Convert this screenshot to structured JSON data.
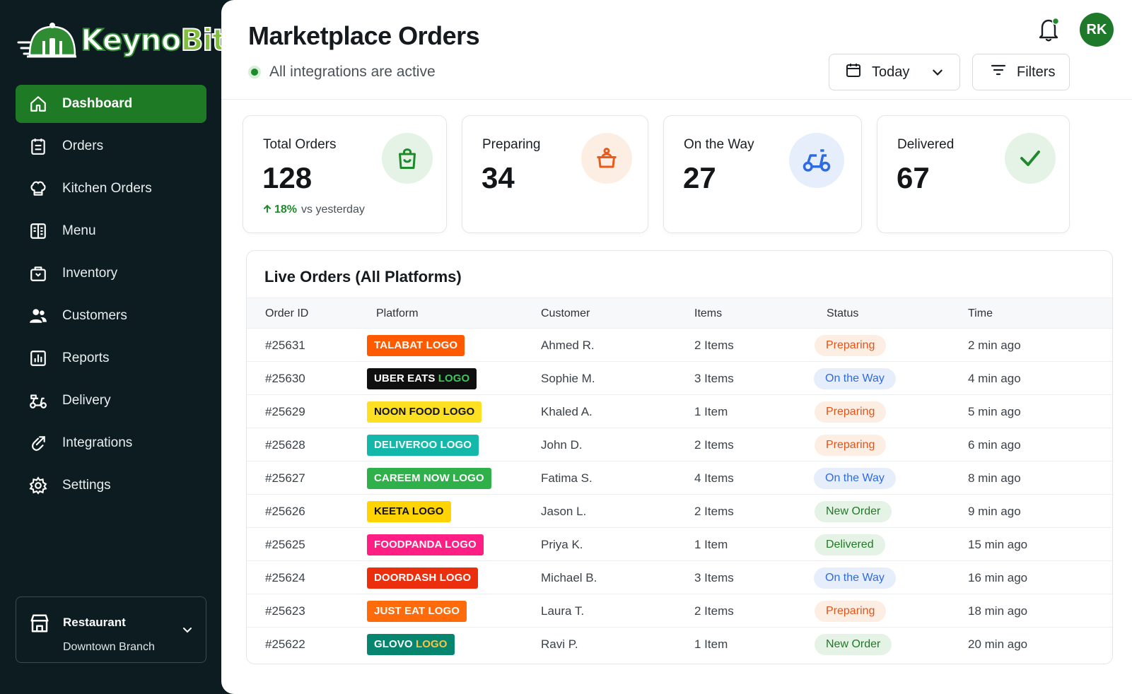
{
  "brand": {
    "name_part1": "Keyno",
    "name_part2": "Bite"
  },
  "sidebar": {
    "items": [
      {
        "label": "Dashboard",
        "icon": "home-icon",
        "active": true
      },
      {
        "label": "Orders",
        "icon": "clipboard-icon",
        "active": false
      },
      {
        "label": "Kitchen Orders",
        "icon": "chef-hat-icon",
        "active": false
      },
      {
        "label": "Menu",
        "icon": "menu-book-icon",
        "active": false
      },
      {
        "label": "Inventory",
        "icon": "box-icon",
        "active": false
      },
      {
        "label": "Customers",
        "icon": "users-icon",
        "active": false
      },
      {
        "label": "Reports",
        "icon": "bar-chart-icon",
        "active": false
      },
      {
        "label": "Delivery",
        "icon": "scooter-icon",
        "active": false
      },
      {
        "label": "Integrations",
        "icon": "link-icon",
        "active": false
      },
      {
        "label": "Settings",
        "icon": "gear-icon",
        "active": false
      }
    ],
    "branch": {
      "title": "Restaurant",
      "subtitle": "Downtown Branch"
    }
  },
  "header": {
    "title": "Marketplace Orders",
    "status": "All integrations are active",
    "date_filter": "Today",
    "filters_label": "Filters",
    "avatar_initials": "RK"
  },
  "stats": [
    {
      "label": "Total Orders",
      "value": "128",
      "trend_pct": "18%",
      "trend_text": "vs yesterday",
      "icon": "shopping-bag-icon",
      "color": "#1f8a2a",
      "bg": "#e5f3e6"
    },
    {
      "label": "Preparing",
      "value": "34",
      "icon": "cooking-pot-icon",
      "color": "#ea5a1a",
      "bg": "#fdeee3"
    },
    {
      "label": "On the Way",
      "value": "27",
      "icon": "scooter-icon",
      "color": "#2f6be0",
      "bg": "#e6eefc"
    },
    {
      "label": "Delivered",
      "value": "67",
      "icon": "check-icon",
      "color": "#1f8a2a",
      "bg": "#e5f3e6"
    }
  ],
  "orders": {
    "title": "Live Orders (All Platforms)",
    "columns": [
      "Order ID",
      "Platform",
      "Customer",
      "Items",
      "Status",
      "Time"
    ],
    "rows": [
      {
        "id": "#25631",
        "platform": "TALABAT LOGO",
        "customer": "Ahmed R.",
        "items": "2 Items",
        "status": "Preparing",
        "time": "2 min ago"
      },
      {
        "id": "#25630",
        "platform": "UBER EATS LOGO",
        "customer": "Sophie M.",
        "items": "3 Items",
        "status": "On the Way",
        "time": "4 min ago"
      },
      {
        "id": "#25629",
        "platform": "NOON FOOD LOGO",
        "customer": "Khaled A.",
        "items": "1 Item",
        "status": "Preparing",
        "time": "5 min ago"
      },
      {
        "id": "#25628",
        "platform": "DELIVEROO LOGO",
        "customer": "John D.",
        "items": "2 Items",
        "status": "Preparing",
        "time": "6 min ago"
      },
      {
        "id": "#25627",
        "platform": "CAREEM NOW LOGO",
        "customer": "Fatima S.",
        "items": "4 Items",
        "status": "On the Way",
        "time": "8 min ago"
      },
      {
        "id": "#25626",
        "platform": "KEETA LOGO",
        "customer": "Jason L.",
        "items": "2 Items",
        "status": "New Order",
        "time": "9 min ago"
      },
      {
        "id": "#25625",
        "platform": "FOODPANDA LOGO",
        "customer": "Priya K.",
        "items": "1 Item",
        "status": "Delivered",
        "time": "15 min ago"
      },
      {
        "id": "#25624",
        "platform": "DOORDASH LOGO",
        "customer": "Michael B.",
        "items": "3 Items",
        "status": "On the Way",
        "time": "16 min ago"
      },
      {
        "id": "#25623",
        "platform": "JUST EAT LOGO",
        "customer": "Laura T.",
        "items": "2 Items",
        "status": "Preparing",
        "time": "18 min ago"
      },
      {
        "id": "#25622",
        "platform": "GLOVO LOGO",
        "customer": "Ravi P.",
        "items": "1 Item",
        "status": "New Order",
        "time": "20 min ago"
      }
    ]
  },
  "colors": {
    "accent": "#1f7a25",
    "sidebar_bg": "#0c1c20",
    "platforms": {
      "TALABAT LOGO": {
        "bg": "#ff5a00",
        "fg": "#ffffff"
      },
      "UBER EATS LOGO": {
        "bg": "#0f0f0f",
        "fg": "#ffffff",
        "accent": "#3cc55a"
      },
      "NOON FOOD LOGO": {
        "bg": "#fde021",
        "fg": "#111111"
      },
      "DELIVEROO LOGO": {
        "bg": "#14b8aa",
        "fg": "#ffffff"
      },
      "CAREEM NOW LOGO": {
        "bg": "#2fb04a",
        "fg": "#ffffff"
      },
      "KEETA LOGO": {
        "bg": "#ffd400",
        "fg": "#111111"
      },
      "FOODPANDA LOGO": {
        "bg": "#ff1f84",
        "fg": "#ffffff"
      },
      "DOORDASH LOGO": {
        "bg": "#eb2e0c",
        "fg": "#ffffff"
      },
      "JUST EAT LOGO": {
        "bg": "#ff6a0a",
        "fg": "#ffffff"
      },
      "GLOVO LOGO": {
        "bg": "#06866f",
        "fg": "#ffffff",
        "accent": "#ffc244"
      }
    },
    "status": {
      "Preparing": {
        "bg": "#fdeee3",
        "fg": "#e3541a"
      },
      "On the Way": {
        "bg": "#e6eefc",
        "fg": "#2f6be0"
      },
      "New Order": {
        "bg": "#e5f3e6",
        "fg": "#1f7a25"
      },
      "Delivered": {
        "bg": "#e5f3e6",
        "fg": "#1f7a25"
      }
    }
  }
}
